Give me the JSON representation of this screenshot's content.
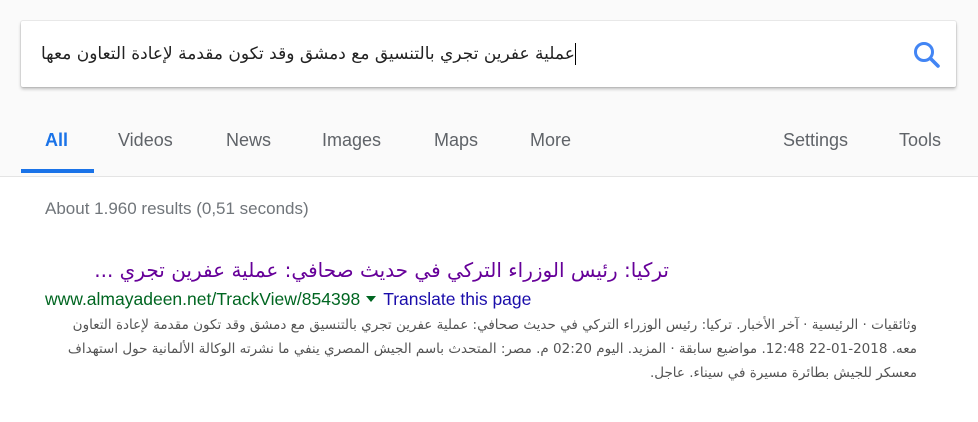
{
  "search": {
    "query": "عملية عفرين تجري بالتنسيق مع دمشق وقد تكون مقدمة لإعادة التعاون معها",
    "search_icon": "search-icon",
    "accent_color": "#4285f4"
  },
  "tabs": [
    {
      "label": "All",
      "active": true
    },
    {
      "label": "Videos"
    },
    {
      "label": "News"
    },
    {
      "label": "Images"
    },
    {
      "label": "Maps"
    },
    {
      "label": "More"
    },
    {
      "label": "Settings"
    },
    {
      "label": "Tools"
    }
  ],
  "stats": "About 1.960 results (0,51 seconds)",
  "result": {
    "title": "تركيا: رئيس الوزراء التركي في حديث صحافي: عملية عفرين تجري ...",
    "url": "www.almayadeen.net/TrackView/854398",
    "translate_label": "Translate this page",
    "snippet": "وثائقيات · الرئيسية · آخر الأخبار. تركيا: رئيس الوزراء التركي في حديث صحافي: عملية عفرين تجري بالتنسيق مع دمشق وقد تكون مقدمة لإعادة التعاون معه. 2018-01-22 12:48. مواضيع سابقة · المزيد. اليوم 02:20 م. مصر: المتحدث باسم الجيش المصري ينفي ما نشرته الوكالة الألمانية حول استهداف معسكر للجيش بطائرة مسيرة في سيناء. عاجل."
  },
  "colors": {
    "title_visited": "#660099",
    "url_green": "#006621",
    "link_blue": "#1a0dab",
    "tab_active": "#1a73e8"
  }
}
